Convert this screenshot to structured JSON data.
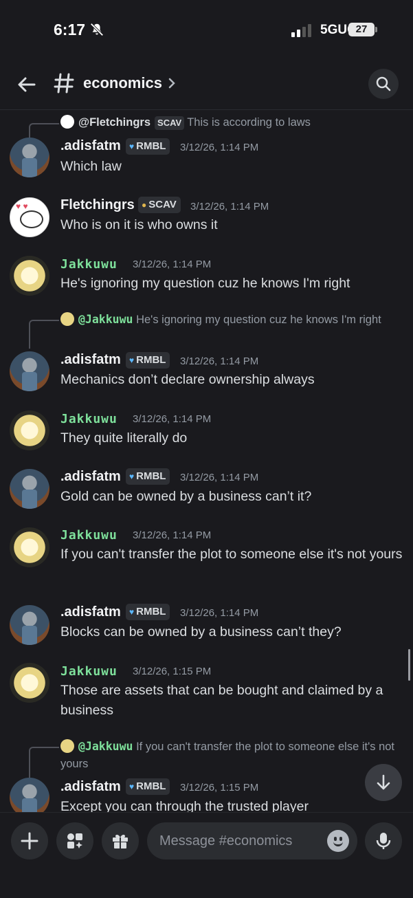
{
  "status_bar": {
    "time": "6:17",
    "network": "5GUC",
    "battery": "27"
  },
  "header": {
    "channel_name": "economics"
  },
  "messages": [
    {
      "reply": {
        "to": "@Fletchingrs",
        "tag": "SCAV",
        "text": "This is according to laws"
      },
      "author": ".adisfatm",
      "tag": "RMBL",
      "time": "3/12/26, 1:14 PM",
      "text": "Which law"
    },
    {
      "author": "Fletchingrs",
      "tag": "SCAV",
      "time": "3/12/26, 1:14 PM",
      "text": "Who is on it is who owns it"
    },
    {
      "author": "Jakkuwu",
      "time": "3/12/26, 1:14 PM",
      "text": "He's ignoring my question cuz he knows I'm right"
    },
    {
      "reply": {
        "to": "@Jakkuwu",
        "text": "He's ignoring my question cuz he knows I'm right"
      },
      "author": ".adisfatm",
      "tag": "RMBL",
      "time": "3/12/26, 1:14 PM",
      "text": "Mechanics don’t declare ownership always"
    },
    {
      "author": "Jakkuwu",
      "time": "3/12/26, 1:14 PM",
      "text": "They quite literally do"
    },
    {
      "author": ".adisfatm",
      "tag": "RMBL",
      "time": "3/12/26, 1:14 PM",
      "text": "Gold can be owned by a business can’t it?"
    },
    {
      "author": "Jakkuwu",
      "time": "3/12/26, 1:14 PM",
      "text": "If you can't transfer the plot to someone else it's not yours"
    },
    {
      "author": ".adisfatm",
      "tag": "RMBL",
      "time": "3/12/26, 1:14 PM",
      "text": "Blocks can be owned by a business can’t they?"
    },
    {
      "author": "Jakkuwu",
      "time": "3/12/26, 1:15 PM",
      "text": "Those are assets that can be bought and claimed by a business"
    },
    {
      "reply": {
        "to": "@Jakkuwu",
        "text": "If you can't transfer the plot to someone else it's not yours"
      },
      "author": ".adisfatm",
      "tag": "RMBL",
      "time": "3/12/26, 1:15 PM",
      "text": "Except you can through the trusted player"
    }
  ],
  "composer": {
    "placeholder": "Message #economics"
  }
}
